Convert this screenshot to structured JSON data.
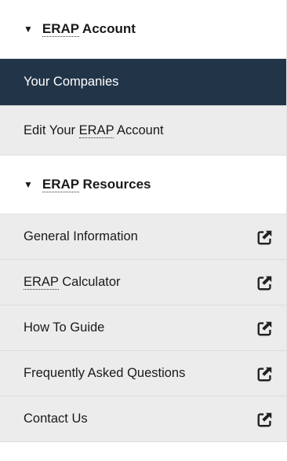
{
  "sections": [
    {
      "header_abbr": "ERAP",
      "header_rest": " Account",
      "collapse_icon": "triangle-down-icon",
      "items": [
        {
          "pre": "Your Companies",
          "abbr": "",
          "post": "",
          "active": true
        },
        {
          "pre": "Edit Your ",
          "abbr": "ERAP",
          "post": " Account",
          "active": false
        }
      ]
    },
    {
      "header_abbr": "ERAP",
      "header_rest": " Resources",
      "collapse_icon": "triangle-down-icon",
      "items": [
        {
          "pre": "General Information",
          "abbr": "",
          "post": "",
          "external": true
        },
        {
          "pre": "",
          "abbr": "ERAP",
          "post": " Calculator",
          "external": true
        },
        {
          "pre": "How To Guide",
          "abbr": "",
          "post": "",
          "external": true
        },
        {
          "pre": "Frequently Asked Questions",
          "abbr": "",
          "post": "",
          "external": true
        },
        {
          "pre": "Contact Us",
          "abbr": "",
          "post": "",
          "external": true
        }
      ]
    }
  ],
  "colors": {
    "active_bg": "#223448",
    "item_bg": "#ececec",
    "header_bg": "#ffffff"
  },
  "external_icon": "external-link-icon",
  "triangle_glyph": "▼"
}
